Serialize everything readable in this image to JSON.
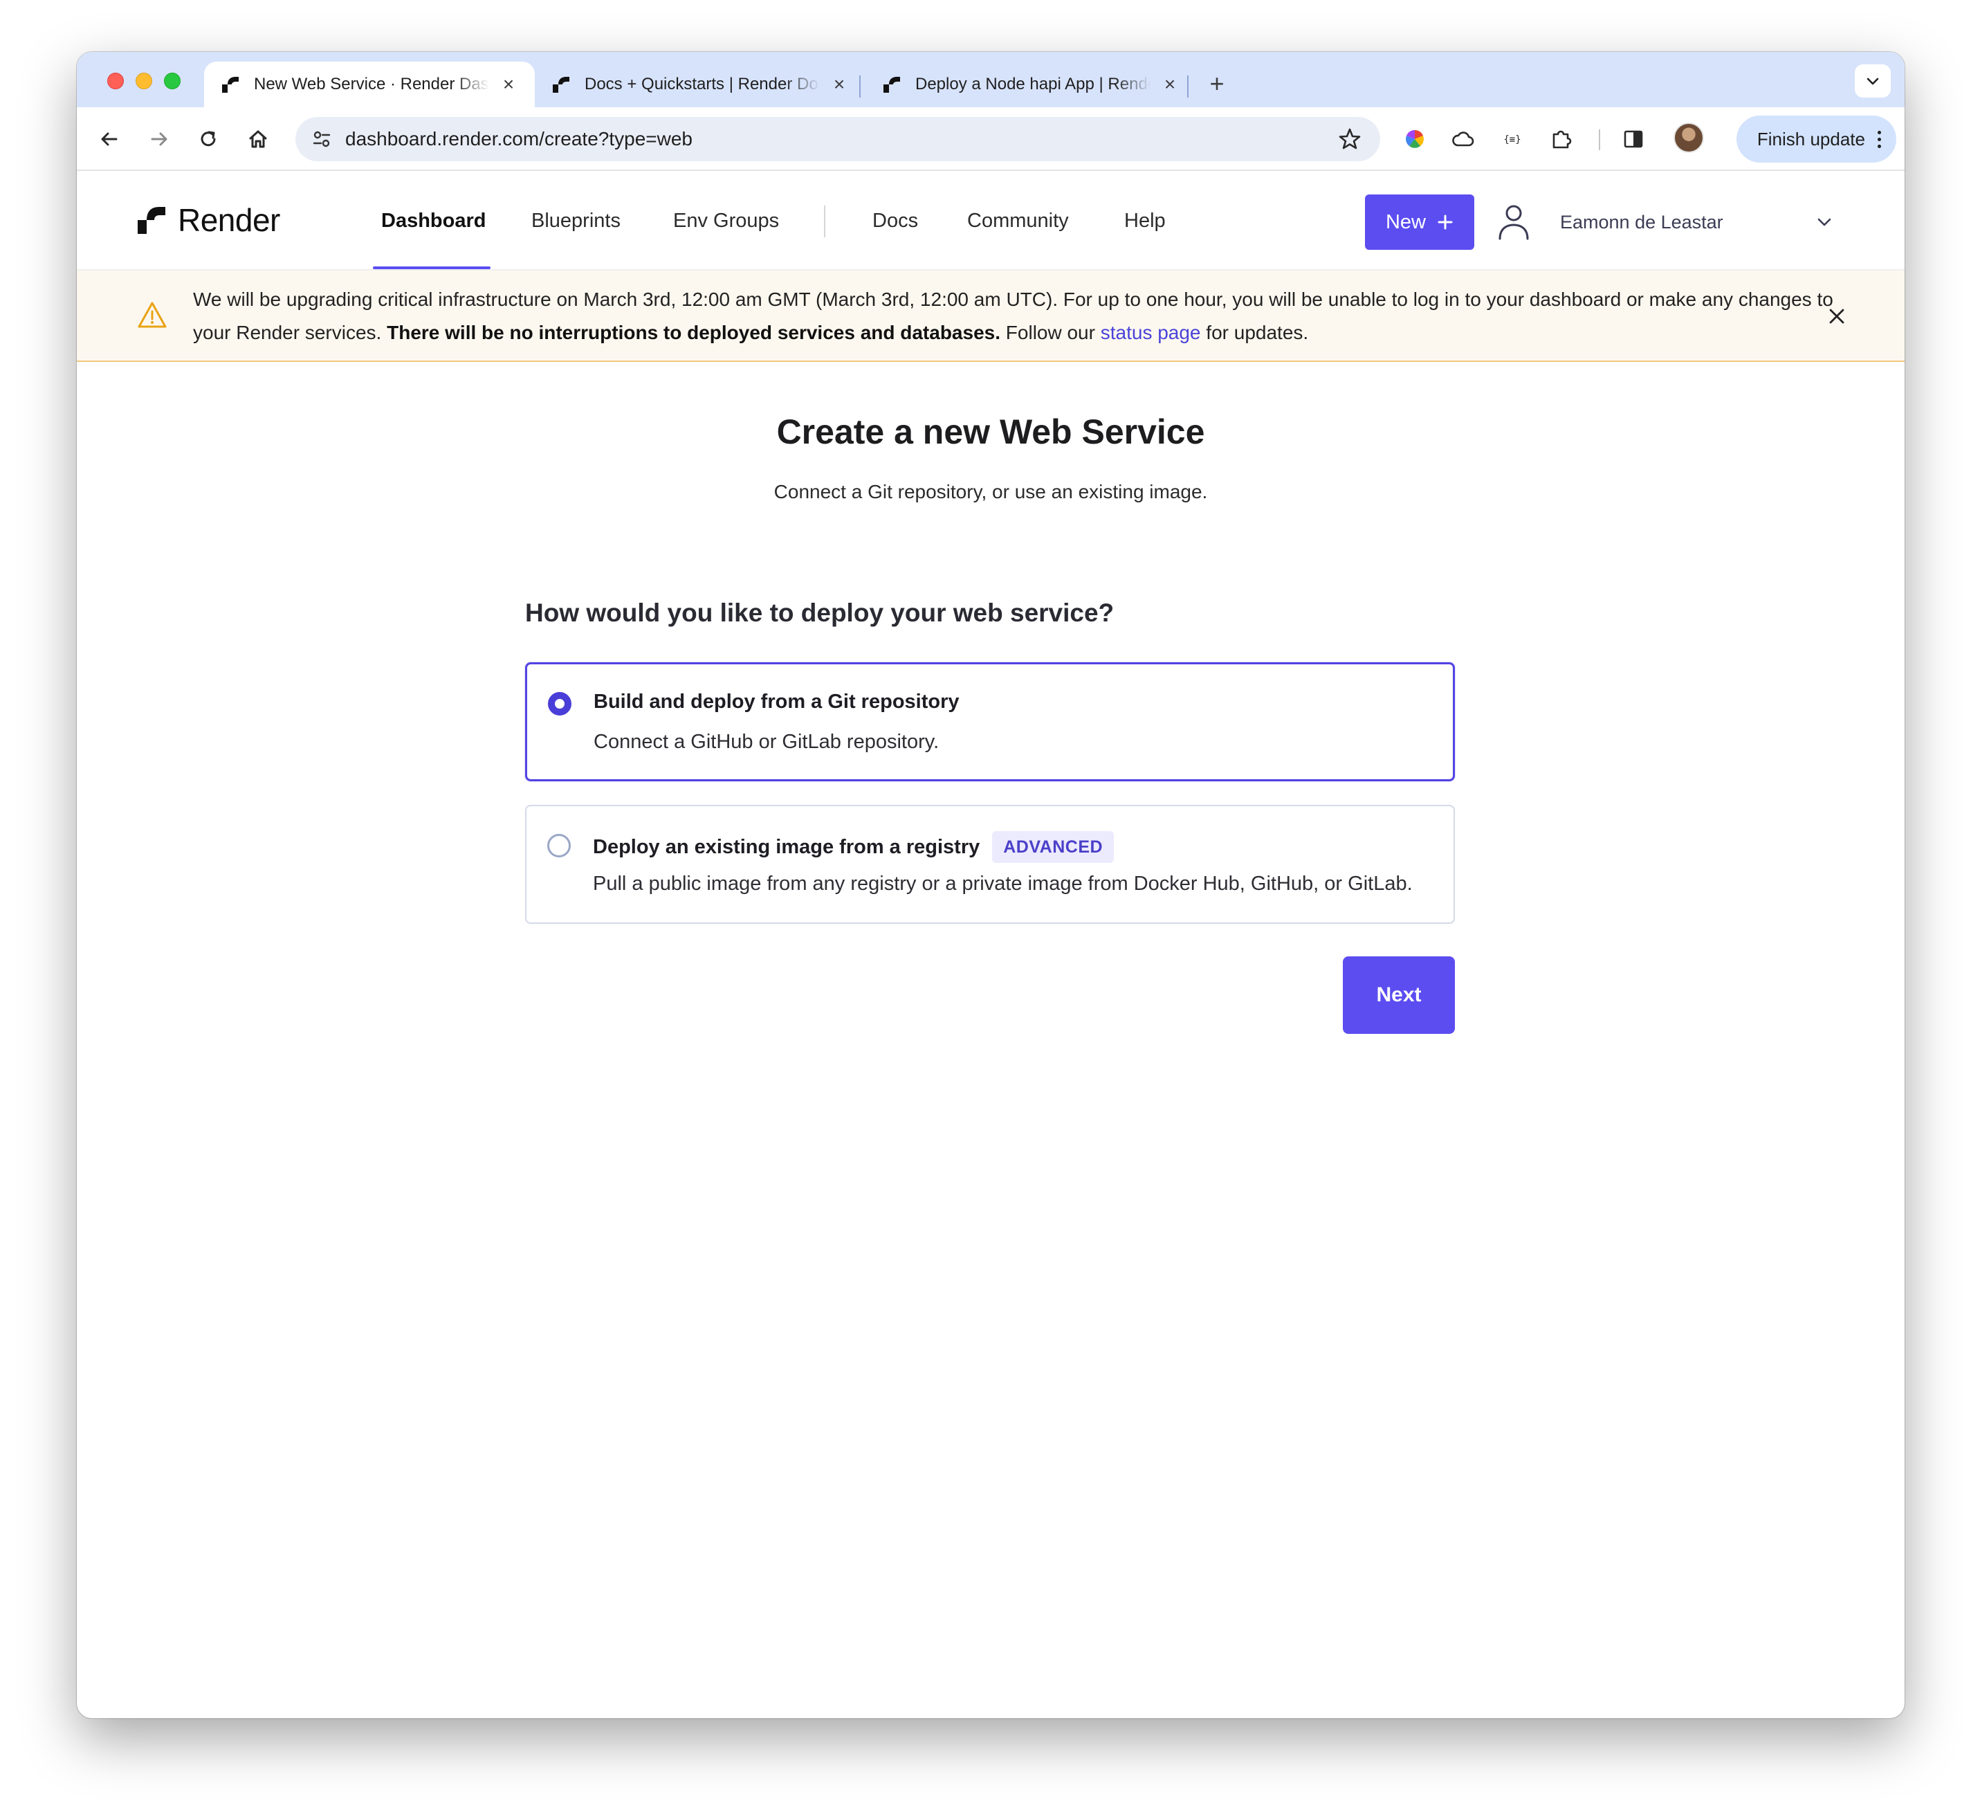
{
  "browser": {
    "tabs": [
      {
        "title": "New Web Service · Render Dashboard",
        "active": true
      },
      {
        "title": "Docs + Quickstarts | Render Docs",
        "active": false
      },
      {
        "title": "Deploy a Node hapi App | Render Docs",
        "active": false
      }
    ],
    "url": "dashboard.render.com/create?type=web",
    "finish_update_label": "Finish update"
  },
  "header": {
    "brand": "Render",
    "nav": [
      "Dashboard",
      "Blueprints",
      "Env Groups",
      "Docs",
      "Community",
      "Help"
    ],
    "active_nav": "Dashboard",
    "new_button": "New",
    "user_name": "Eamonn de Leastar"
  },
  "banner": {
    "text_part1": "We will be upgrading critical infrastructure on March 3rd, 12:00 am GMT (March 3rd, 12:00 am UTC). For up to one hour, you will be unable to log in to your dashboard or make any changes to your Render services. ",
    "bold_text": "There will be no interruptions to deployed services and databases.",
    "text_part2": " Follow our ",
    "link_text": "status page",
    "text_part3": " for updates."
  },
  "main": {
    "title_prefix": "Create a new ",
    "title_bold": "Web Service",
    "subtitle": "Connect a Git repository, or use an existing image.",
    "question": "How would you like to deploy your web service?",
    "options": [
      {
        "title": "Build and deploy from a Git repository",
        "description": "Connect a GitHub or GitLab repository.",
        "selected": true
      },
      {
        "title": "Deploy an existing image from a registry",
        "badge": "ADVANCED",
        "description": "Pull a public image from any registry or a private image from Docker Hub, GitHub, or GitLab.",
        "selected": false
      }
    ],
    "next_button": "Next"
  },
  "colors": {
    "accent": "#5b4df0",
    "tabstrip": "#d7e3fb",
    "banner_bg": "#fdf8ef",
    "warning": "#e8a317"
  },
  "icons": [
    "back-icon",
    "forward-icon",
    "reload-icon",
    "home-icon",
    "site-settings-icon",
    "star-icon",
    "color-extension-icon",
    "cloud-icon",
    "json-icon",
    "puzzle-icon",
    "side-panel-icon",
    "warning-icon",
    "close-icon",
    "user-icon",
    "chevron-down-icon",
    "plus-icon"
  ]
}
